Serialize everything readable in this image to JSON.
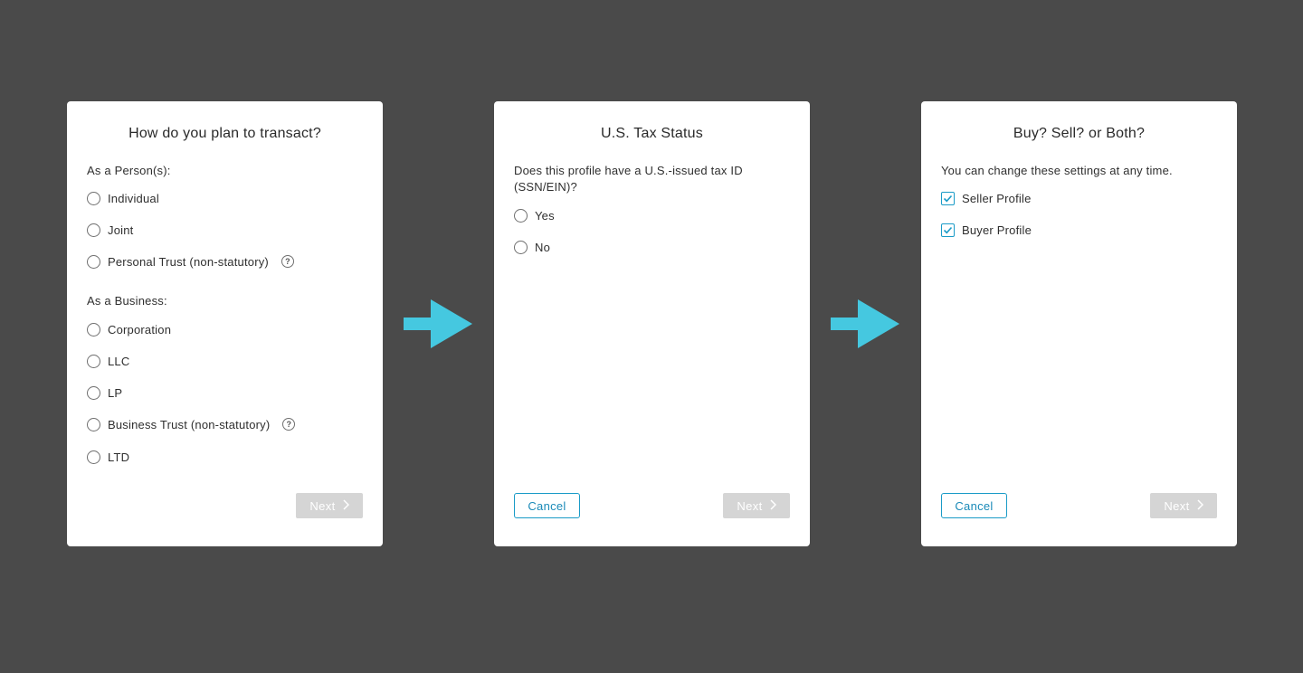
{
  "colors": {
    "background": "#4a4a4a",
    "card": "#ffffff",
    "accent": "#1a9bc7",
    "arrow": "#45c8e0",
    "disabled_button": "#d5d5d5"
  },
  "step1": {
    "title": "How do you plan to transact?",
    "person_label": "As a Person(s):",
    "person_options": [
      "Individual",
      "Joint",
      "Personal Trust (non-statutory)"
    ],
    "business_label": "As a Business:",
    "business_options": [
      "Corporation",
      "LLC",
      "LP",
      "Business Trust (non-statutory)",
      "LTD"
    ],
    "help_glyph": "?",
    "next_label": "Next"
  },
  "step2": {
    "title": "U.S. Tax Status",
    "question": "Does this profile have a U.S.-issued tax ID (SSN/EIN)?",
    "options": [
      "Yes",
      "No"
    ],
    "cancel_label": "Cancel",
    "next_label": "Next"
  },
  "step3": {
    "title": "Buy? Sell? or Both?",
    "description": "You can change these settings at any time.",
    "options": [
      {
        "label": "Seller Profile",
        "checked": true
      },
      {
        "label": "Buyer Profile",
        "checked": true
      }
    ],
    "cancel_label": "Cancel",
    "next_label": "Next"
  }
}
